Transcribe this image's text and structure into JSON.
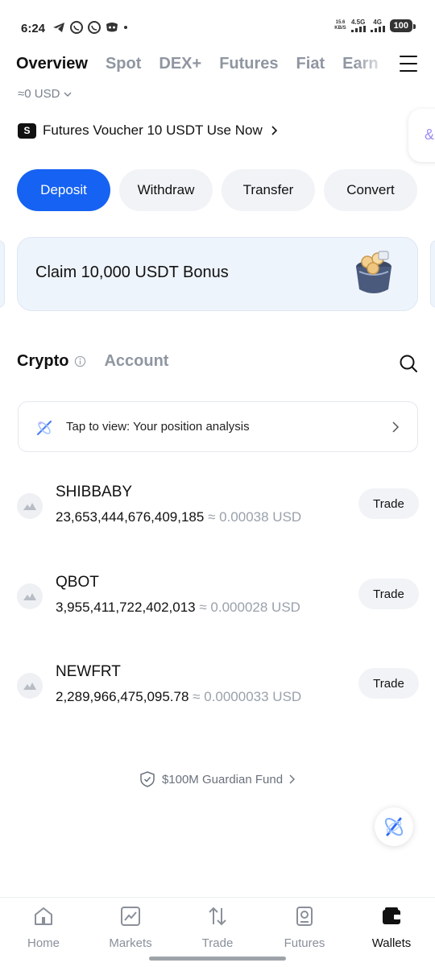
{
  "status_bar": {
    "time": "6:24",
    "net_speed_value": "15.6",
    "net_speed_unit": "KB/S",
    "network_1": "4.5G",
    "network_2": "4G",
    "battery": "100"
  },
  "top_tabs": [
    {
      "label": "Overview",
      "active": true
    },
    {
      "label": "Spot",
      "active": false
    },
    {
      "label": "DEX+",
      "active": false
    },
    {
      "label": "Futures",
      "active": false
    },
    {
      "label": "Fiat",
      "active": false
    },
    {
      "label": "Earn",
      "active": false
    }
  ],
  "balance": {
    "value": "≈0 USD"
  },
  "voucher": {
    "text": "Futures Voucher 10 USDT Use Now",
    "icon_letter": "S"
  },
  "actions": [
    "Deposit",
    "Withdraw",
    "Transfer",
    "Convert"
  ],
  "bonus": {
    "text": "Claim 10,000 USDT Bonus"
  },
  "sub_tabs": {
    "crypto": "Crypto",
    "account": "Account"
  },
  "analysis": {
    "text": "Tap to view: Your position analysis"
  },
  "assets": [
    {
      "name": "SHIBBABY",
      "amount": "23,653,444,676,409,185",
      "value": "≈ 0.00038 USD",
      "trade": "Trade"
    },
    {
      "name": "QBOT",
      "amount": "3,955,411,722,402,013",
      "value": "≈ 0.000028 USD",
      "trade": "Trade"
    },
    {
      "name": "NEWFRT",
      "amount": "2,289,966,475,095.78",
      "value": "≈ 0.0000033 USD",
      "trade": "Trade"
    }
  ],
  "guardian": {
    "text": "$100M Guardian Fund"
  },
  "bottom_nav": [
    {
      "label": "Home",
      "icon": "home-icon",
      "active": false
    },
    {
      "label": "Markets",
      "icon": "markets-icon",
      "active": false
    },
    {
      "label": "Trade",
      "icon": "trade-icon",
      "active": false
    },
    {
      "label": "Futures",
      "icon": "futures-icon",
      "active": false
    },
    {
      "label": "Wallets",
      "icon": "wallet-icon",
      "active": true
    }
  ],
  "colors": {
    "accent": "#1662f2",
    "muted": "#8f96a1",
    "card": "#eef4fc"
  }
}
